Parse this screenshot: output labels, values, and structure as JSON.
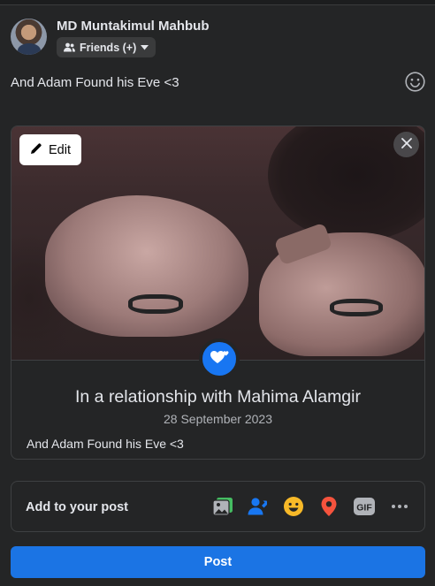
{
  "composer": {
    "user_name": "MD Muntakimul Mahbub",
    "audience_label": "Friends (+)",
    "post_text": "And Adam Found his Eve <3"
  },
  "life_event": {
    "edit_label": "Edit",
    "title": "In a relationship with Mahima Alamgir",
    "date": "28 September 2023",
    "caption": "And Adam Found his Eve <3"
  },
  "add_to_post": {
    "label": "Add to your post",
    "tools": [
      "photo-video-icon",
      "tag-people-icon",
      "feeling-activity-icon",
      "check-in-icon",
      "gif-icon",
      "more-icon"
    ]
  },
  "post_button_label": "Post",
  "colors": {
    "background": "#242526",
    "accent": "#1b74e4",
    "check_in": "#f5533d",
    "feeling": "#f7b928"
  }
}
